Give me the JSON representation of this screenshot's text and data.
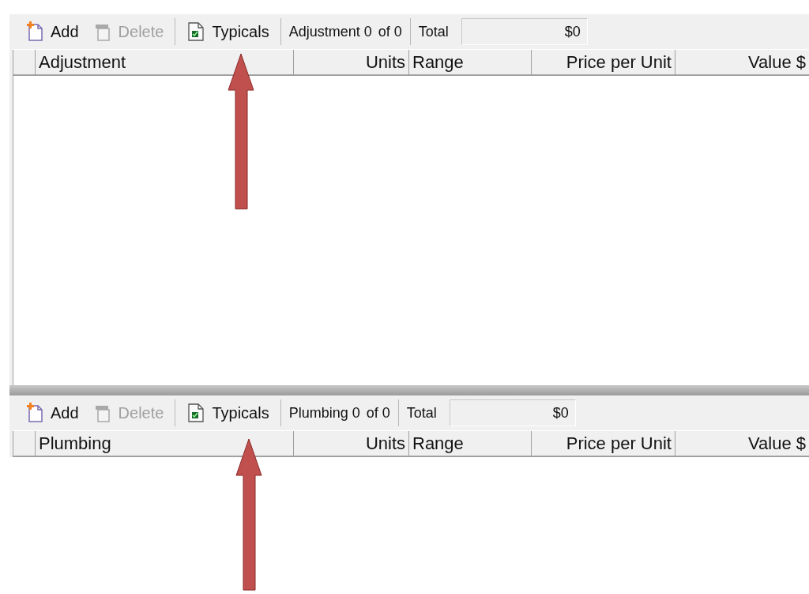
{
  "sections": [
    {
      "toolbar": {
        "buttons": [
          {
            "kind": "add",
            "label": "Add",
            "disabled": false
          },
          {
            "kind": "delete",
            "label": "Delete",
            "disabled": true
          },
          {
            "kind": "typicals",
            "label": "Typicals",
            "disabled": false
          }
        ],
        "counter": "Adjustment 0",
        "of": "of 0",
        "total_label": "Total",
        "total_value": "$0"
      },
      "columns": [
        "Adjustment",
        "Units",
        "Range",
        "Price per Unit",
        "Value $"
      ]
    },
    {
      "toolbar": {
        "buttons": [
          {
            "kind": "add",
            "label": "Add",
            "disabled": false
          },
          {
            "kind": "delete",
            "label": "Delete",
            "disabled": true
          },
          {
            "kind": "typicals",
            "label": "Typicals",
            "disabled": false
          }
        ],
        "counter": "Plumbing 0",
        "of": "of 0",
        "total_label": "Total",
        "total_value": "$0"
      },
      "columns": [
        "Plumbing",
        "Units",
        "Range",
        "Price per Unit",
        "Value $"
      ]
    }
  ]
}
